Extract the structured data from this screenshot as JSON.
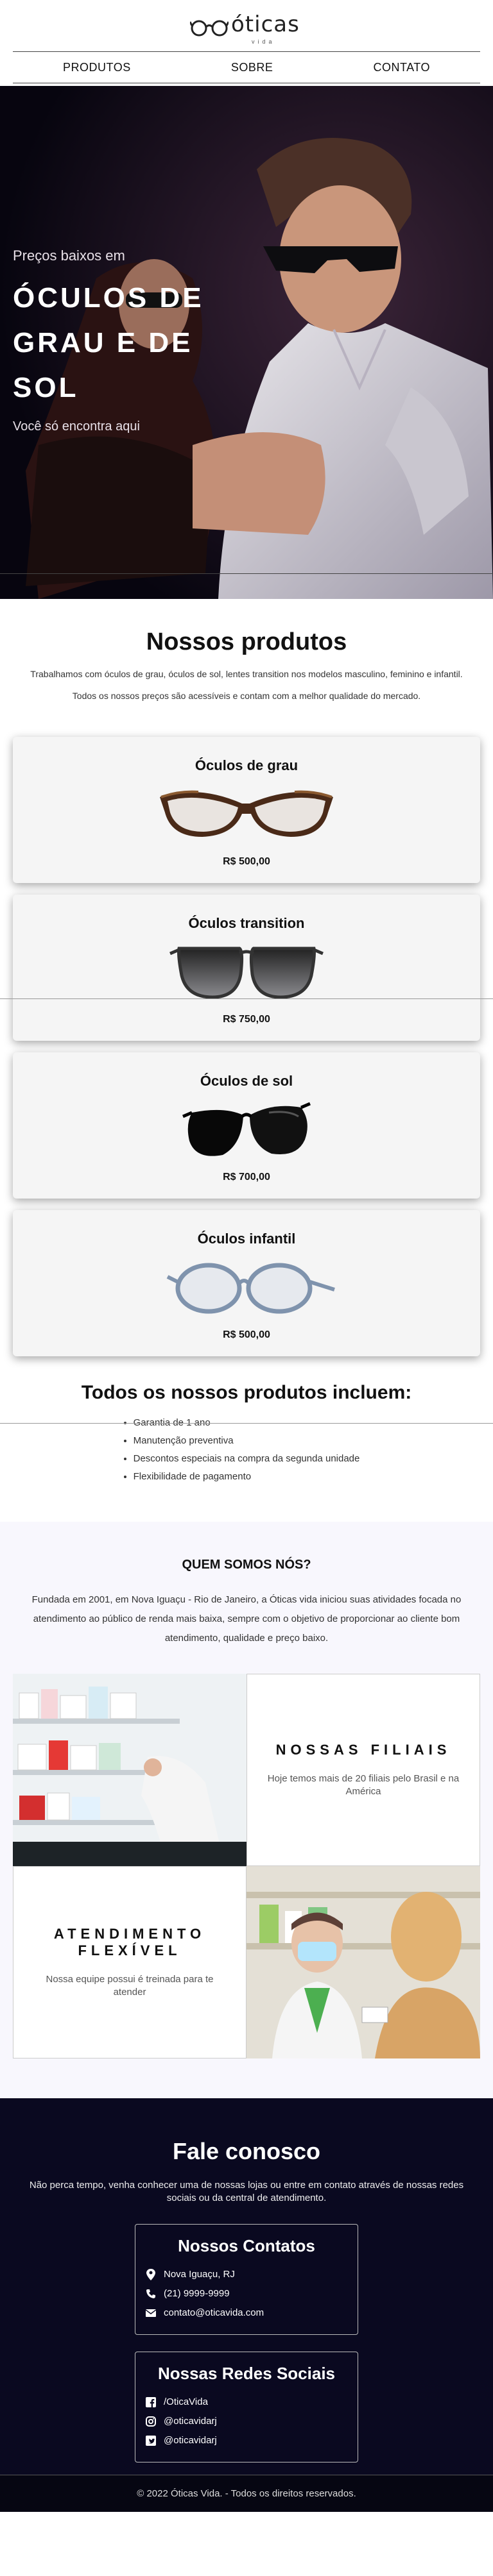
{
  "brand": {
    "name": "óticas",
    "sub": "vida"
  },
  "nav": {
    "items": [
      "PRODUTOS",
      "SOBRE",
      "CONTATO"
    ]
  },
  "hero": {
    "kicker": "Preços baixos em",
    "title_l1": "ÓCULOS DE",
    "title_l2": "GRAU E DE",
    "title_l3": "SOL",
    "tagline": "Você só encontra aqui"
  },
  "products": {
    "title": "Nossos produtos",
    "intro": "Trabalhamos com óculos de grau, óculos de sol, lentes transition nos modelos masculino, feminino e infantil.",
    "intro2": "Todos os nossos preços são acessíveis e contam com a melhor qualidade do mercado.",
    "items": [
      {
        "name": "Óculos de grau",
        "price": "R$ 500,00",
        "icon": "cat-eye-tortoise-glasses"
      },
      {
        "name": "Óculos transition",
        "price": "R$ 750,00",
        "icon": "dark-gray-sunglasses"
      },
      {
        "name": "Óculos de sol",
        "price": "R$ 700,00",
        "icon": "black-round-sunglasses"
      },
      {
        "name": "Óculos infantil",
        "price": "R$ 500,00",
        "icon": "blue-gray-kids-glasses"
      }
    ]
  },
  "includes": {
    "title": "Todos os nossos produtos incluem:",
    "items": [
      "Garantia de 1 ano",
      "Manutenção preventiva",
      "Descontos especiais na compra da segunda unidade",
      "Flexibilidade de pagamento"
    ]
  },
  "about": {
    "title": "QUEM SOMOS NÓS?",
    "text": "Fundada em 2001, em Nova Iguaçu - Rio de Janeiro, a Óticas vida iniciou suas atividades focada no atendimento ao público de renda mais baixa, sempre com o objetivo de proporcionar ao cliente bom atendimento, qualidade e preço baixo.",
    "branches_title": "NOSSAS FILIAIS",
    "branches_text": "Hoje temos mais de 20 filiais pelo Brasil e na América",
    "service_title": "ATENDIMENTO FLEXÍVEL",
    "service_text": "Nossa equipe possui é treinada para te atender"
  },
  "contact": {
    "title": "Fale conosco",
    "intro": "Não perca tempo, venha conhecer uma de nossas lojas ou entre em contato através de nossas redes sociais ou da central de atendimento.",
    "contacts_title": "Nossos Contatos",
    "location": "Nova Iguaçu, RJ",
    "phone": "(21) 9999-9999",
    "email": "contato@oticavida.com",
    "social_title": "Nossas Redes Sociais",
    "facebook": "/OticaVida",
    "instagram": "@oticavidarj",
    "twitter": "@oticavidarj"
  },
  "footer": {
    "text": "© 2022 Óticas Vida. - Todos os direitos reservados."
  },
  "colors": {
    "hero_bg": "#0a0714",
    "contact_bg": "#0a0920",
    "about_bg": "#f8f7fd",
    "card_bg": "#f5f5f5"
  }
}
